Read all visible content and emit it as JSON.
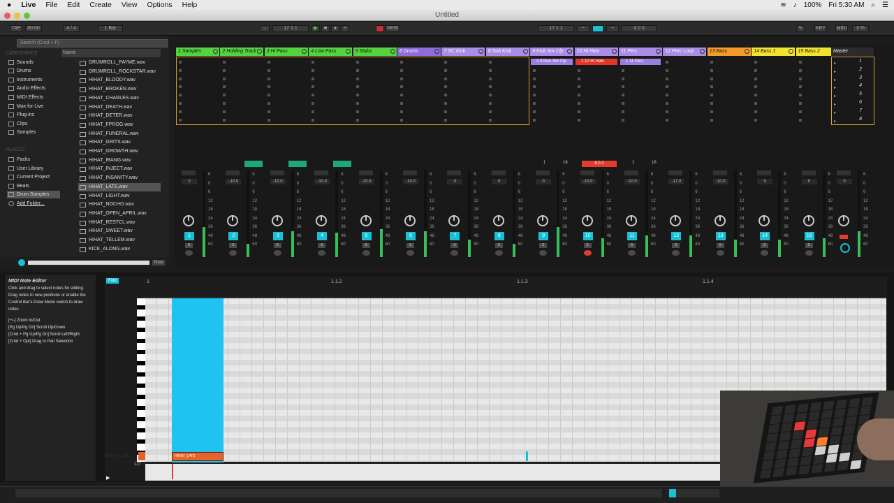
{
  "menubar": {
    "apple": "",
    "app": "Live",
    "items": [
      "File",
      "Edit",
      "Create",
      "View",
      "Options",
      "Help"
    ],
    "battery": "100%",
    "clock": "Fri 5:30 AM"
  },
  "window": {
    "title": "Untitled"
  },
  "control_bar": {
    "tap": "TAP",
    "tempo": "80.00",
    "sig": "4 / 4",
    "quant": "1 Bar",
    "position": "17   1   1",
    "new": "NEW",
    "loop_start": "17   1   1",
    "loop_len": "4   0   0",
    "key": "KEY",
    "midi": "MIDI",
    "cpu": "3 %"
  },
  "browser": {
    "search_placeholder": "Search (Cmd + F)",
    "header_categories": "CATEGORIES",
    "categories": [
      "Sounds",
      "Drums",
      "Instruments",
      "Audio Effects",
      "MIDI Effects",
      "Max for Live",
      "Plug-ins",
      "Clips",
      "Samples"
    ],
    "header_places": "PLACES",
    "places": [
      "Packs",
      "User Library",
      "Current Project",
      "Beats",
      "Drum Samples",
      "Add Folder..."
    ],
    "column_name": "Name",
    "files": [
      "DRUMROLL_PAYME.wav",
      "DRUMROLL_ROCKSTAR.wav",
      "HIHAT_BLOODY.wav",
      "HIHAT_BROKEN.wav",
      "HIHAT_CHARLES.wav",
      "HIHAT_DEATH.wav",
      "HIHAT_DETER.wav",
      "HIHAT_FPROG.wav",
      "HIHAT_FUNERAL.wav",
      "HIHAT_GRITS.wav",
      "HIHAT_GROWTH.wav",
      "HIHAT_IBANG.wav",
      "HIHAT_INJECT.wav",
      "HIHAT_INSANITY.wav",
      "HIHAT_LATE.wav",
      "HIHAT_LIGHT.wav",
      "HIHAT_NOCHO.wav",
      "HIHAT_OPEN_APRIL.wav",
      "HIHAT_RESTCL.wav",
      "HIHAT_SWEET.wav",
      "HIHAT_TELLEM.wav",
      "KICK_ALONG.wav"
    ],
    "selected_file": "HIHAT_LATE.wav",
    "preview": "Raw"
  },
  "session": {
    "tracks": [
      {
        "name": "1 Samples",
        "color": "#53d33f"
      },
      {
        "name": "2 Holding Track",
        "color": "#53d33f"
      },
      {
        "name": "3 Hi Pass",
        "color": "#53d33f"
      },
      {
        "name": "4 Low Pass",
        "color": "#53d33f"
      },
      {
        "name": "5 Stabs",
        "color": "#53d33f"
      },
      {
        "name": "6 Drums",
        "color": "#8f6cdc"
      },
      {
        "name": "7 SC Kick",
        "color": "#a88ce6"
      },
      {
        "name": "8 Sub Kick",
        "color": "#a88ce6"
      },
      {
        "name": "9 Kick Snr Clp",
        "color": "#a88ce6"
      },
      {
        "name": "10 Hi Hats",
        "color": "#a88ce6"
      },
      {
        "name": "11 Perc",
        "color": "#a88ce6"
      },
      {
        "name": "12 Perc Loop",
        "color": "#a88ce6"
      },
      {
        "name": "13 Bass",
        "color": "#f59b2a"
      },
      {
        "name": "14 Bass 1",
        "color": "#f2e330"
      },
      {
        "name": "15 Bass 2",
        "color": "#f2e330"
      },
      {
        "name": "Master",
        "color": "#2b2b2b"
      }
    ],
    "clips": [
      {
        "label": "3 9 Kick Snr Clp"
      },
      {
        "label": "1 10 Hi Hats"
      },
      {
        "label": "1 11 Perc"
      }
    ],
    "scenes": [
      "1",
      "2",
      "3",
      "4",
      "5",
      "6",
      "7",
      "8"
    ],
    "clip_counter": "8.0.1",
    "pads": [
      "1",
      "16",
      "1",
      "16"
    ],
    "mixer_numbers": [
      "1",
      "2",
      "3",
      "4",
      "5",
      "6",
      "7",
      "8",
      "9",
      "10",
      "11",
      "12",
      "13",
      "14",
      "15"
    ],
    "volumes": [
      "0",
      "-10.0",
      "-10.0",
      "-10.0",
      "-10.0",
      "-10.0",
      "0",
      "0",
      "0",
      "-10.0",
      "-10.0",
      "-17.0",
      "-10.0",
      "0",
      "0",
      "0",
      "0"
    ],
    "solo": "S",
    "scale": [
      "6",
      "0",
      "6",
      "12",
      "18",
      "24",
      "36",
      "48",
      "60"
    ]
  },
  "detail": {
    "info_title": "MIDI Note Editor",
    "info_body": "Click and drag to select notes for editing. Drag notes to new positions or enable the Control Bar's Draw Mode switch to draw notes.",
    "info_shortcuts": [
      "[+/-] Zoom In/Out",
      "[Pg Up/Pg Dn] Scroll Up/Down",
      "[Cmd + Pg Up/Pg Dn] Scroll Left/Right",
      "[Cmd + Opt] Drag to Pan Selection"
    ],
    "fold": "Fold",
    "ruler": [
      "1",
      "1.1.2",
      "1.1.3",
      "1.1.4"
    ],
    "note_name": "HIHAT_LATE",
    "key_label": "HIHAT_LATE",
    "velocity": "127"
  }
}
